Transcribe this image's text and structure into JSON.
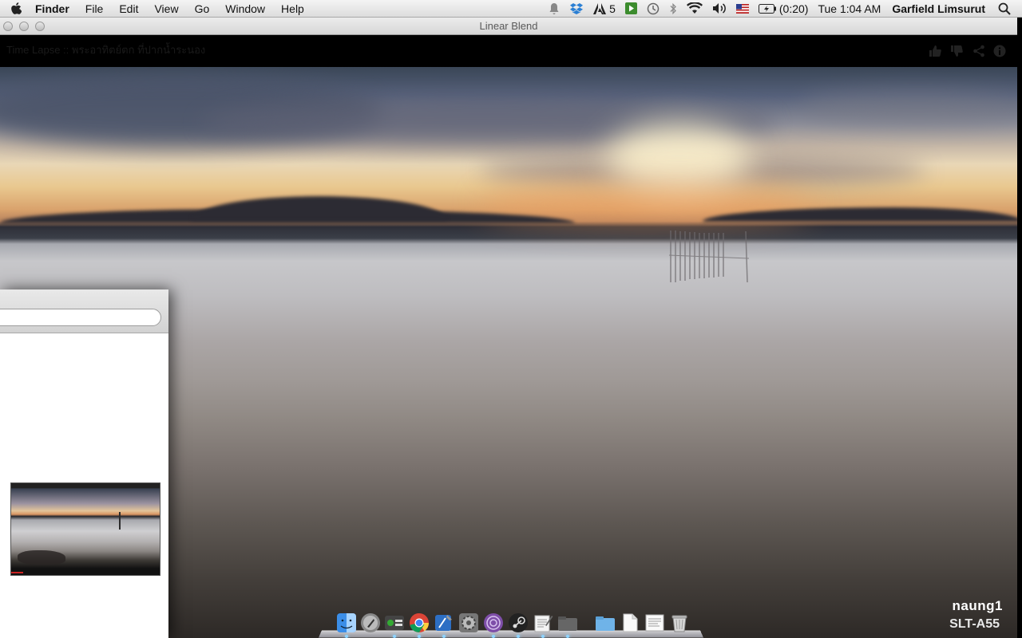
{
  "menubar": {
    "app_name": "Finder",
    "menus": [
      "File",
      "Edit",
      "View",
      "Go",
      "Window",
      "Help"
    ],
    "adobe_count": "5",
    "battery_time": "(0:20)",
    "clock": "Tue 1:04 AM",
    "user": "Garfield Limsurut",
    "icons": [
      "notification-icon",
      "dropbox-icon",
      "adobe-icon",
      "media-icon",
      "time-machine-icon",
      "bluetooth-icon",
      "wifi-icon",
      "volume-icon",
      "flag-icon",
      "battery-icon",
      "spotlight-icon"
    ]
  },
  "window": {
    "title": "Linear Blend",
    "video_title": "Time Lapse :: พระอาทิตย์ตก ที่ปากน้ำระนอง",
    "header_icons": [
      "like-icon",
      "dislike-icon",
      "share-icon",
      "info-icon"
    ]
  },
  "watermark": {
    "line1": "naung1",
    "line2": "SLT-A55"
  },
  "left_panel": {
    "search_value": ""
  },
  "dock": {
    "items": [
      "finder",
      "launchpad",
      "dashboard",
      "chrome",
      "xcode",
      "system-preferences",
      "tor",
      "steam",
      "textedit",
      "folder",
      "documents",
      "file",
      "text-document",
      "trash"
    ]
  }
}
